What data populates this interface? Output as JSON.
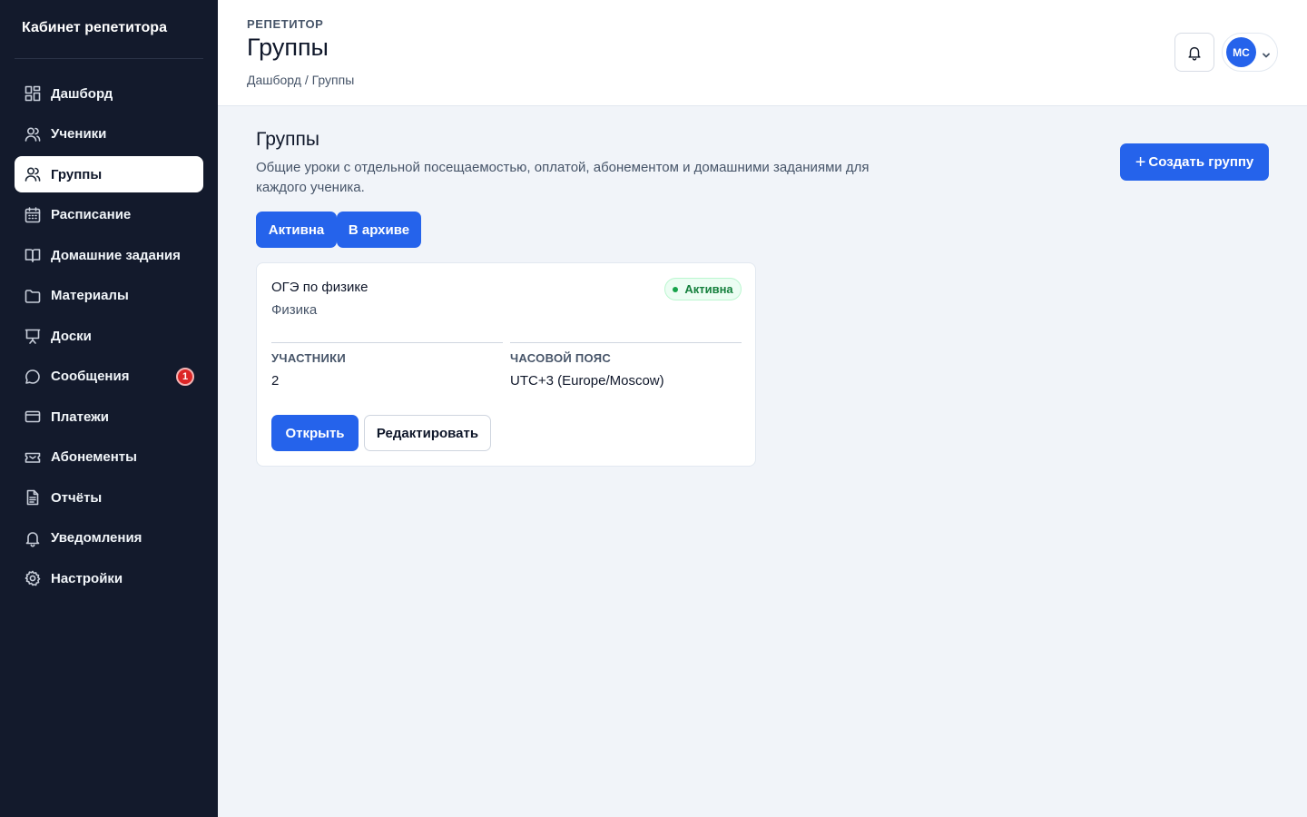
{
  "sidebar": {
    "brand": "Кабинет репетитора",
    "items": [
      {
        "label": "Дашборд",
        "icon": "dashboard-icon"
      },
      {
        "label": "Ученики",
        "icon": "users-icon"
      },
      {
        "label": "Группы",
        "icon": "users-icon",
        "active": true
      },
      {
        "label": "Расписание",
        "icon": "calendar-icon"
      },
      {
        "label": "Домашние задания",
        "icon": "book-open-icon"
      },
      {
        "label": "Материалы",
        "icon": "folder-icon"
      },
      {
        "label": "Доски",
        "icon": "presentation-icon"
      },
      {
        "label": "Сообщения",
        "icon": "message-icon",
        "badge": "1"
      },
      {
        "label": "Платежи",
        "icon": "credit-card-icon"
      },
      {
        "label": "Абонементы",
        "icon": "ticket-icon"
      },
      {
        "label": "Отчёты",
        "icon": "file-text-icon"
      },
      {
        "label": "Уведомления",
        "icon": "bell-icon"
      },
      {
        "label": "Настройки",
        "icon": "gear-icon"
      }
    ]
  },
  "header": {
    "eyebrow": "РЕПЕТИТОР",
    "title": "Группы",
    "breadcrumb": "Дашборд / Группы",
    "avatar_initials": "МС"
  },
  "main": {
    "title": "Группы",
    "description": "Общие уроки с отдельной посещаемостью, оплатой, абонементом и домашними заданиями для каждого ученика.",
    "create_button": "Создать группу",
    "tabs": [
      "Активна",
      "В архиве"
    ],
    "groups": [
      {
        "title": "ОГЭ по физике",
        "subject": "Физика",
        "status": "Активна",
        "participants_label": "УЧАСТНИКИ",
        "participants": "2",
        "timezone_label": "ЧАСОВОЙ ПОЯС",
        "timezone": "UTC+3 (Europe/Moscow)",
        "open_label": "Открыть",
        "edit_label": "Редактировать"
      }
    ]
  },
  "colors": {
    "sidebar_bg": "#131a2c",
    "accent": "#2563eb",
    "badge": "#dc2626",
    "status_green": "#15803d"
  }
}
